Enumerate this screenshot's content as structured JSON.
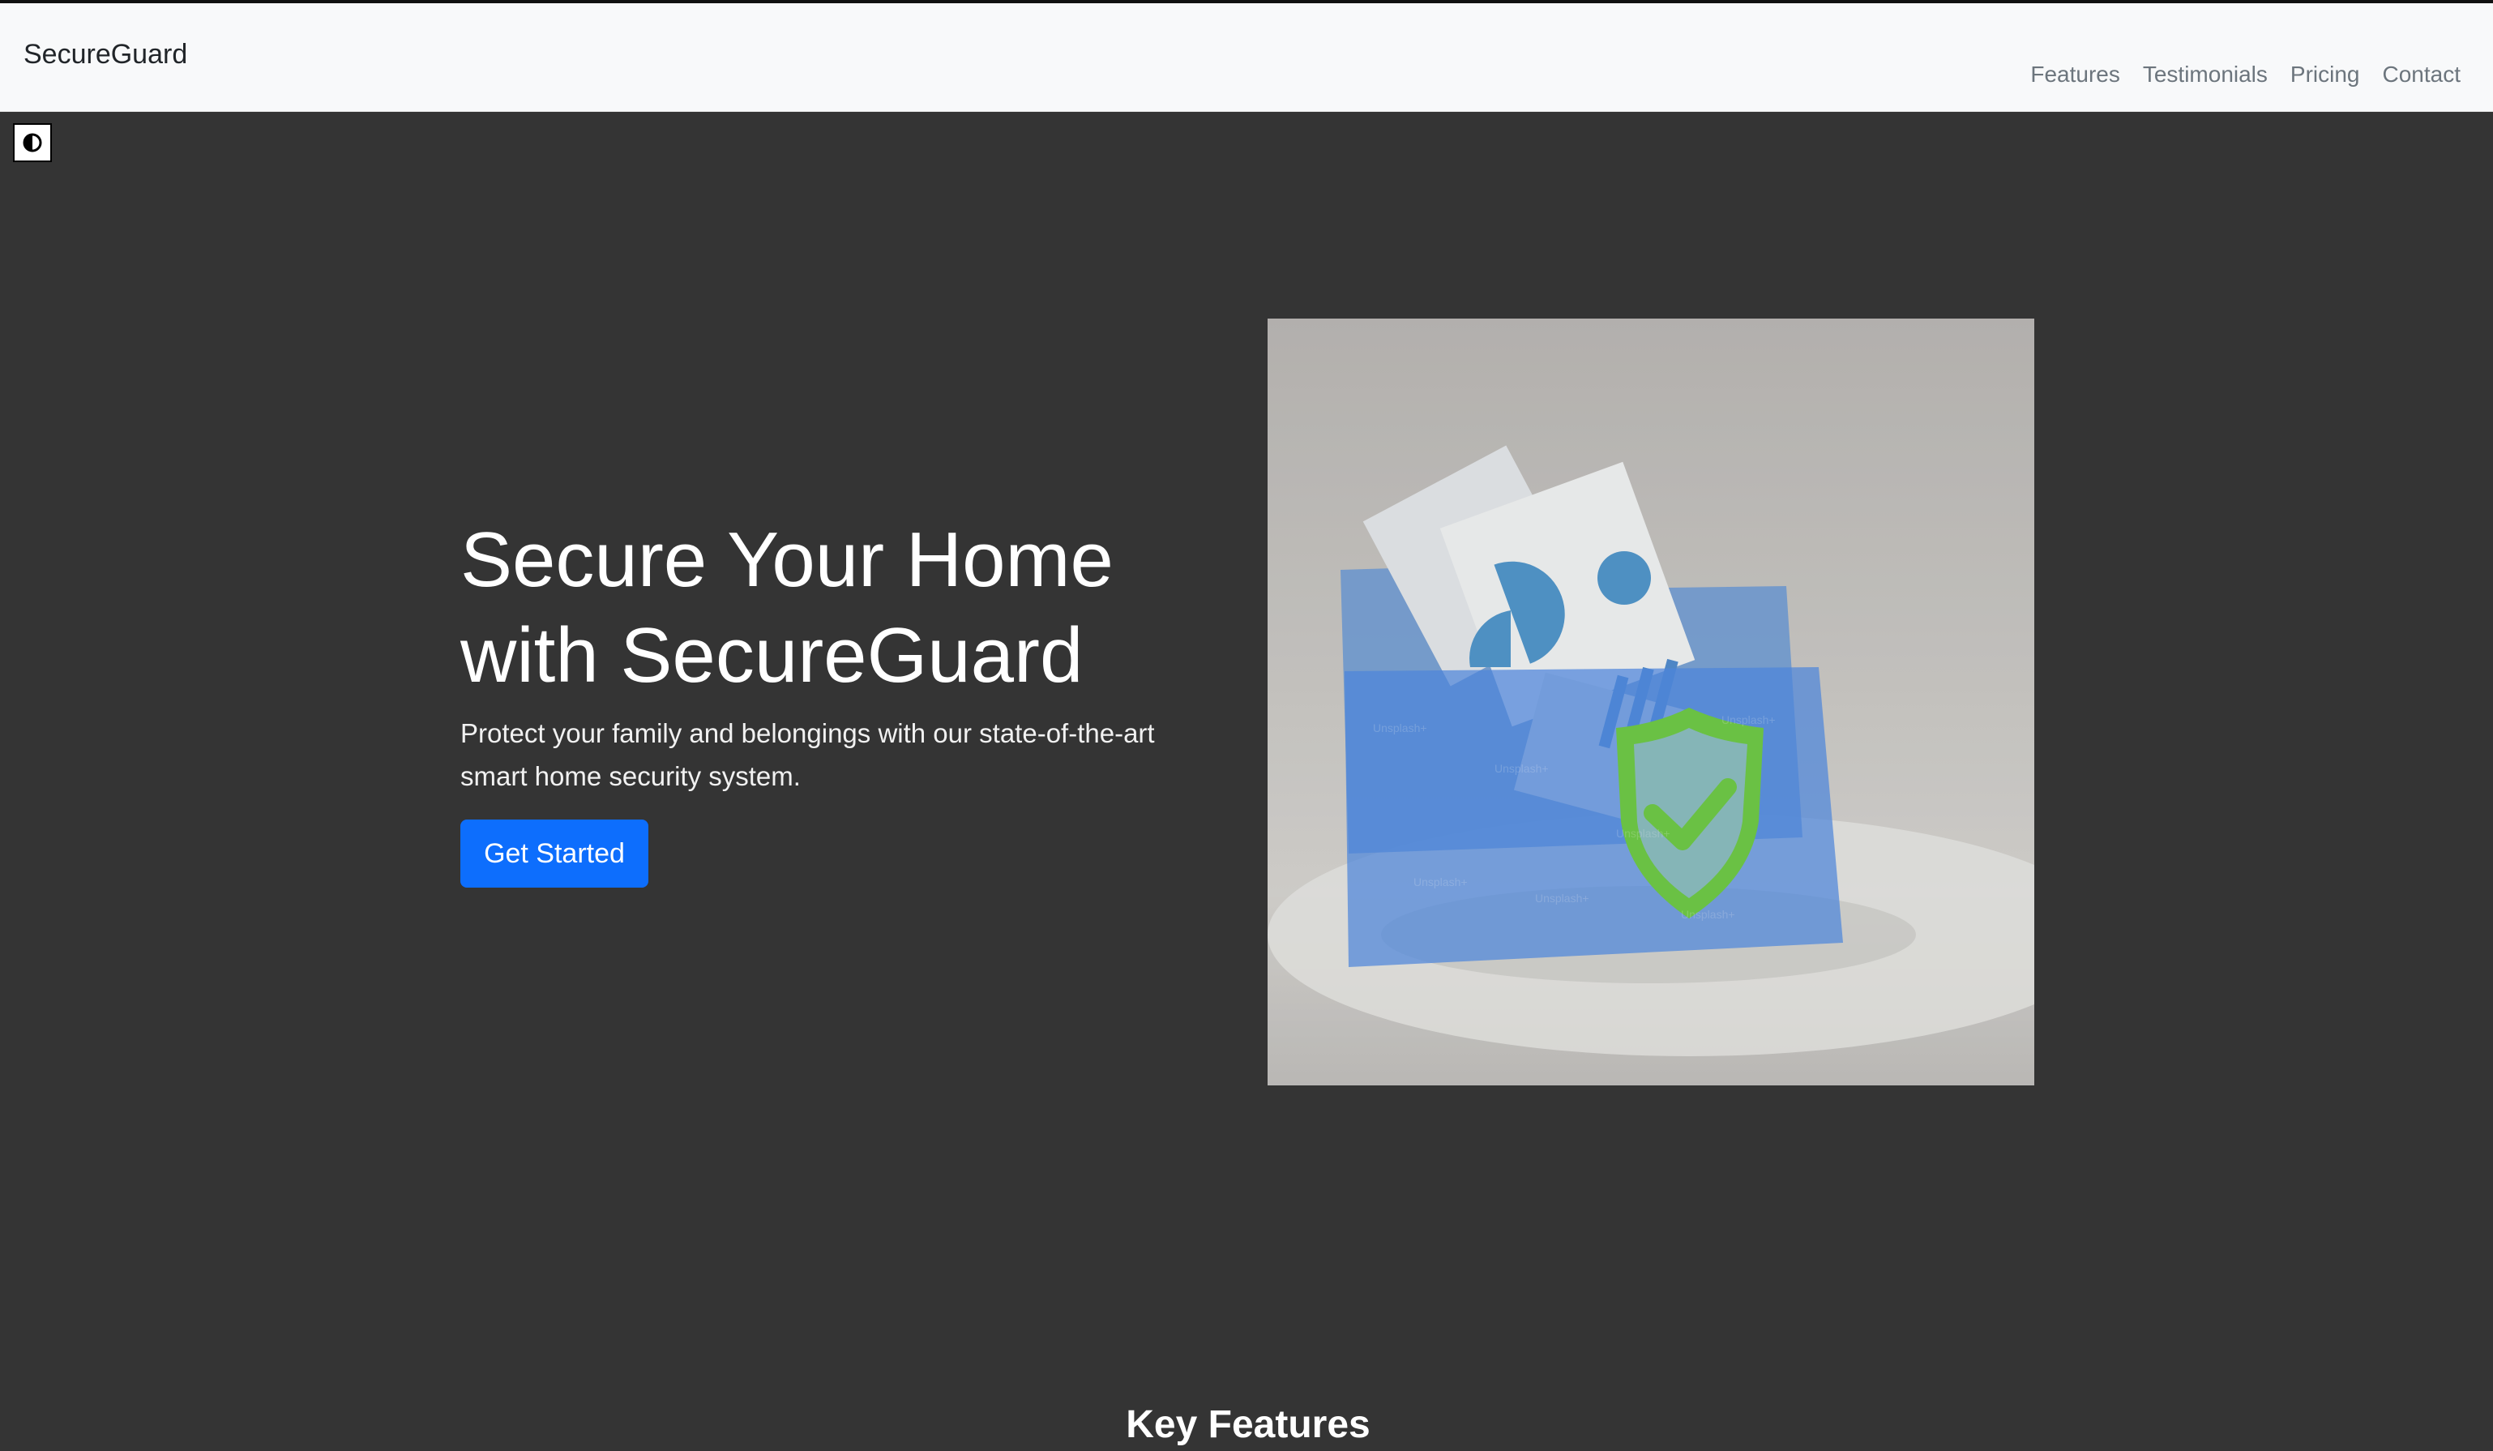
{
  "brand": {
    "name": "SecureGuard"
  },
  "nav": {
    "links": [
      {
        "label": "Features"
      },
      {
        "label": "Testimonials"
      },
      {
        "label": "Pricing"
      },
      {
        "label": "Contact"
      }
    ]
  },
  "theme_toggle": {
    "icon": "contrast-icon"
  },
  "hero": {
    "title": "Secure Your Home with SecureGuard",
    "subtitle": "Protect your family and belongings with our state-of-the-art smart home security system.",
    "cta_label": "Get Started",
    "image": {
      "watermark": "Unsplash+"
    }
  },
  "next_section": {
    "heading": "Key Features"
  },
  "colors": {
    "page_background": "#343434",
    "navbar_background": "#f8f9fa",
    "accent": "#0d6efd",
    "shield": "#5fc235"
  }
}
